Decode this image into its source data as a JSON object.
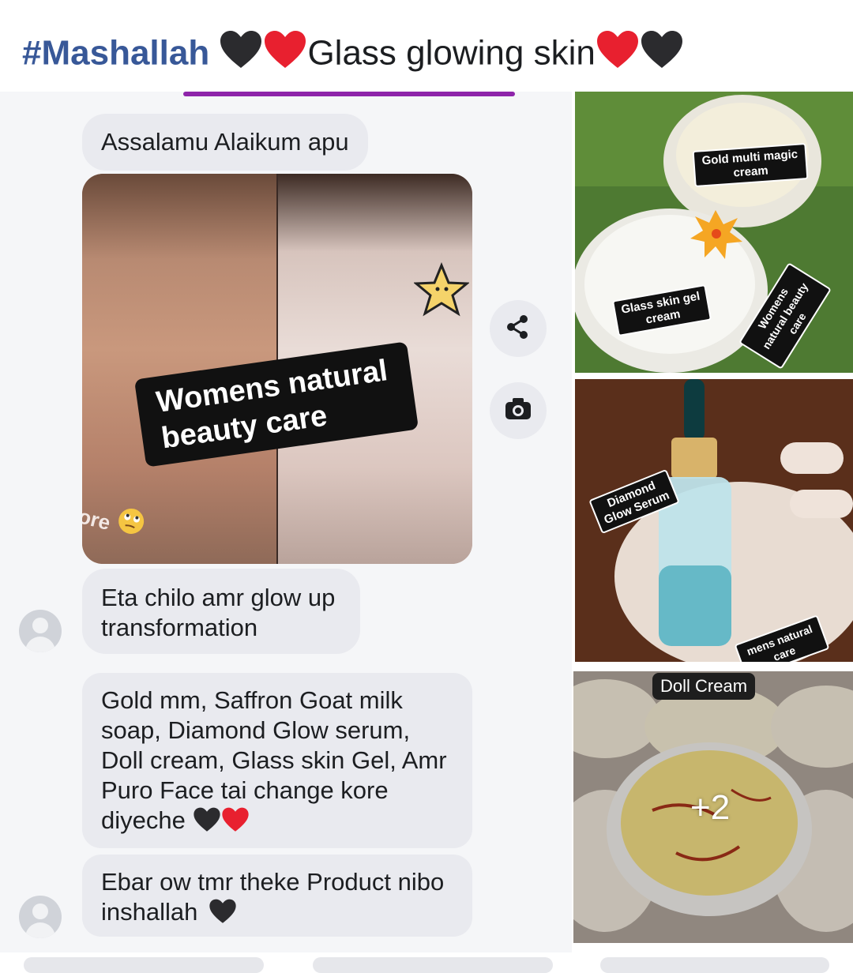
{
  "post": {
    "hashtag": "#Mashallah",
    "title_text": "Glass glowing skin"
  },
  "chat": {
    "messages": [
      "Assalamu Alaikum apu",
      "Eta chilo amr glow up transformation",
      "Gold mm, Saffron Goat milk soap, Diamond Glow serum, Doll cream, Glass skin Gel, Amr Puro Face tai change kore diyeche",
      "Ebar ow tmr theke Product nibo inshallah"
    ],
    "photo_watermark": "Womens natural beauty care",
    "photo_before_label": "ore"
  },
  "tiles": {
    "tile1_label_top": "Gold multi magic cream",
    "tile1_label_bottom": "Glass skin gel cream",
    "tile1_watermark": "Womens natural beauty care",
    "tile2_label": "Diamond Glow Serum",
    "tile2_watermark": "mens natural care",
    "tile3_label": "Doll Cream",
    "more_count": "+2"
  },
  "colors": {
    "hashtag": "#385898",
    "bubble": "#e9eaef",
    "accent_line": "#8e24aa",
    "heart_red": "#e8202f",
    "heart_black": "#2b2b2e"
  },
  "icons": [
    "black-heart-icon",
    "red-heart-icon",
    "share-icon",
    "camera-icon",
    "avatar-icon",
    "star-sticker-icon",
    "rolling-eyes-emoji-icon"
  ]
}
